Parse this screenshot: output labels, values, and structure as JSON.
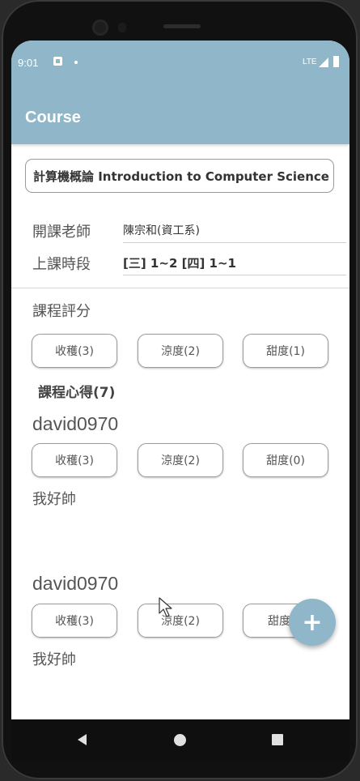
{
  "status_bar": {
    "time": "9:01",
    "network": "LTE"
  },
  "app_bar": {
    "title": "Course"
  },
  "course": {
    "name": "計算機概論 Introduction to Computer Science",
    "teacher_label": "開課老師",
    "teacher_value": "陳宗和(資工系)",
    "time_label": "上課時段",
    "time_value": "[三] 1~2 [四] 1~1"
  },
  "rating": {
    "label": "課程評分",
    "harvest": "收穫(3)",
    "easy": "涼度(2)",
    "sweet": "甜度(1)"
  },
  "reviews": {
    "heading": "課程心得(7)",
    "items": [
      {
        "user": "david0970",
        "harvest": "收穫(3)",
        "easy": "涼度(2)",
        "sweet": "甜度(0)",
        "text": "我好帥"
      },
      {
        "user": "david0970",
        "harvest": "收穫(3)",
        "easy": "涼度(2)",
        "sweet": "甜度(",
        "text": "我好帥"
      }
    ]
  },
  "fab": {
    "label": "+"
  },
  "icons": {
    "notification": "notification-icon",
    "signal": "signal-icon",
    "battery": "battery-icon",
    "back": "back-icon",
    "home": "home-icon",
    "recents": "recents-icon",
    "cursor": "mouse-cursor-icon"
  },
  "colors": {
    "primary": "#8fb7c9"
  }
}
